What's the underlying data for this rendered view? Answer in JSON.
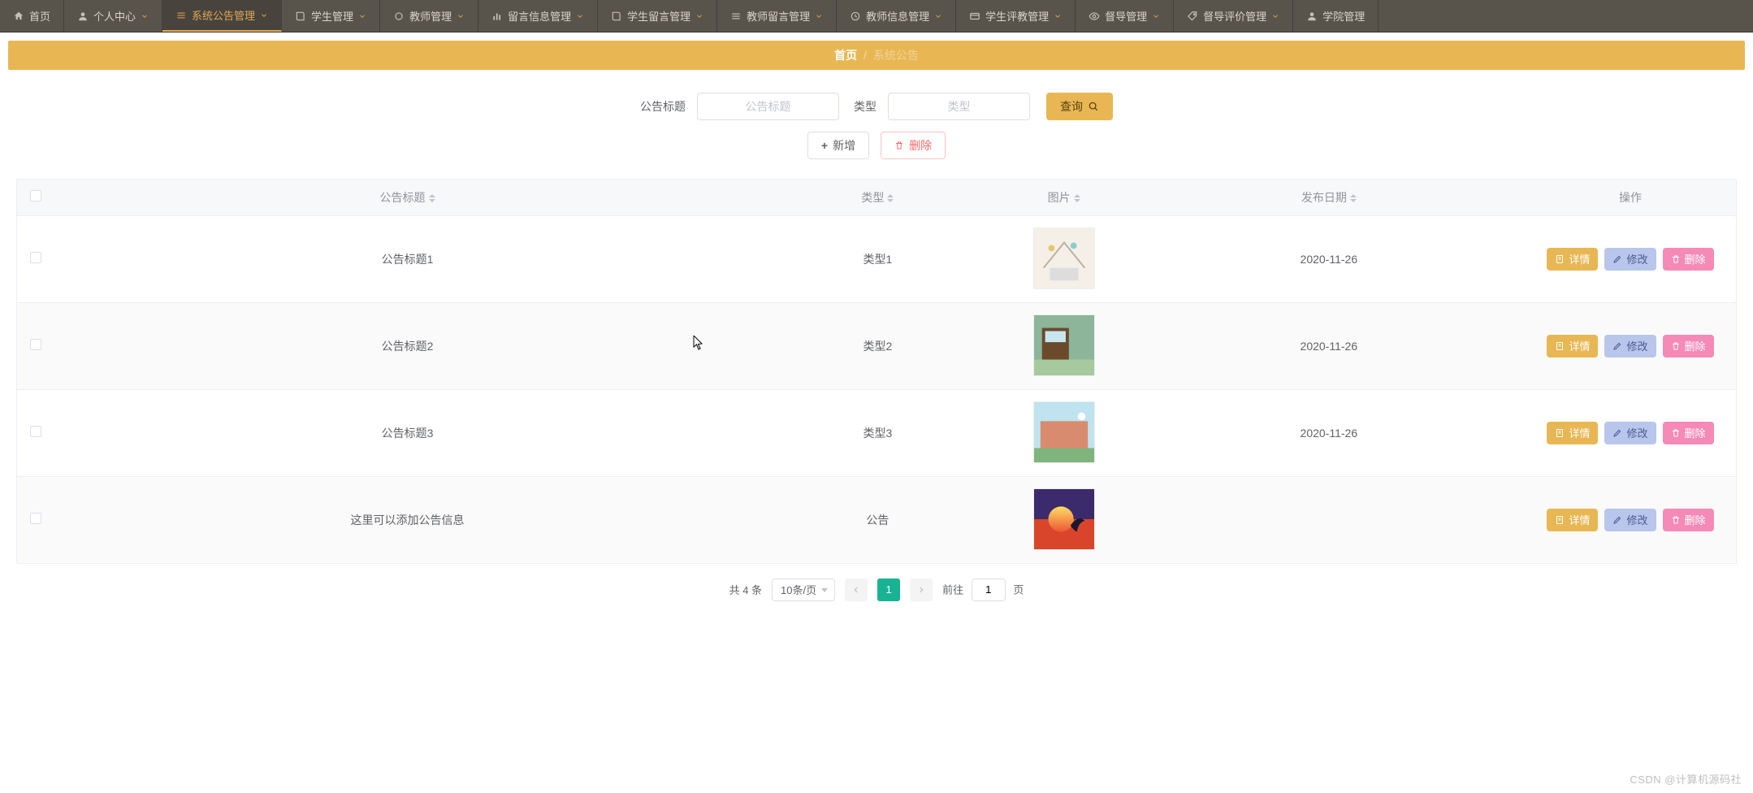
{
  "nav": [
    {
      "label": "首页",
      "icon": "home-icon",
      "chev": false
    },
    {
      "label": "个人中心",
      "icon": "user-icon",
      "chev": true
    },
    {
      "label": "系统公告管理",
      "icon": "menu-icon",
      "chev": true,
      "active": true
    },
    {
      "label": "学生管理",
      "icon": "book-icon",
      "chev": true
    },
    {
      "label": "教师管理",
      "icon": "ring-icon",
      "chev": true
    },
    {
      "label": "留言信息管理",
      "icon": "bar-icon",
      "chev": true
    },
    {
      "label": "学生留言管理",
      "icon": "book-icon",
      "chev": true
    },
    {
      "label": "教师留言管理",
      "icon": "menu-icon",
      "chev": true
    },
    {
      "label": "教师信息管理",
      "icon": "clock-icon",
      "chev": true
    },
    {
      "label": "学生评教管理",
      "icon": "card-icon",
      "chev": true
    },
    {
      "label": "督导管理",
      "icon": "eye-icon",
      "chev": true
    },
    {
      "label": "督导评价管理",
      "icon": "tag-icon",
      "chev": true
    },
    {
      "label": "学院管理",
      "icon": "user-icon",
      "chev": false
    }
  ],
  "breadcrumb": {
    "home": "首页",
    "sep": "/",
    "current": "系统公告"
  },
  "filter": {
    "title_label": "公告标题",
    "title_placeholder": "公告标题",
    "type_label": "类型",
    "type_placeholder": "类型",
    "search_label": "查询"
  },
  "actions": {
    "add": "新增",
    "del": "删除"
  },
  "columns": {
    "title": "公告标题",
    "type": "类型",
    "image": "图片",
    "date": "发布日期",
    "ops": "操作"
  },
  "rowbtn": {
    "detail": "详情",
    "edit": "修改",
    "del": "删除"
  },
  "rows": [
    {
      "title": "公告标题1",
      "type": "类型1",
      "date": "2020-11-26"
    },
    {
      "title": "公告标题2",
      "type": "类型2",
      "date": "2020-11-26"
    },
    {
      "title": "公告标题3",
      "type": "类型3",
      "date": "2020-11-26"
    },
    {
      "title": "这里可以添加公告信息",
      "type": "公告",
      "date": ""
    }
  ],
  "pagination": {
    "total_text": "共 4 条",
    "pagesize": "10条/页",
    "current": "1",
    "jump_prefix": "前往",
    "jump_value": "1",
    "jump_suffix": "页"
  },
  "watermark": "CSDN @计算机源码社"
}
